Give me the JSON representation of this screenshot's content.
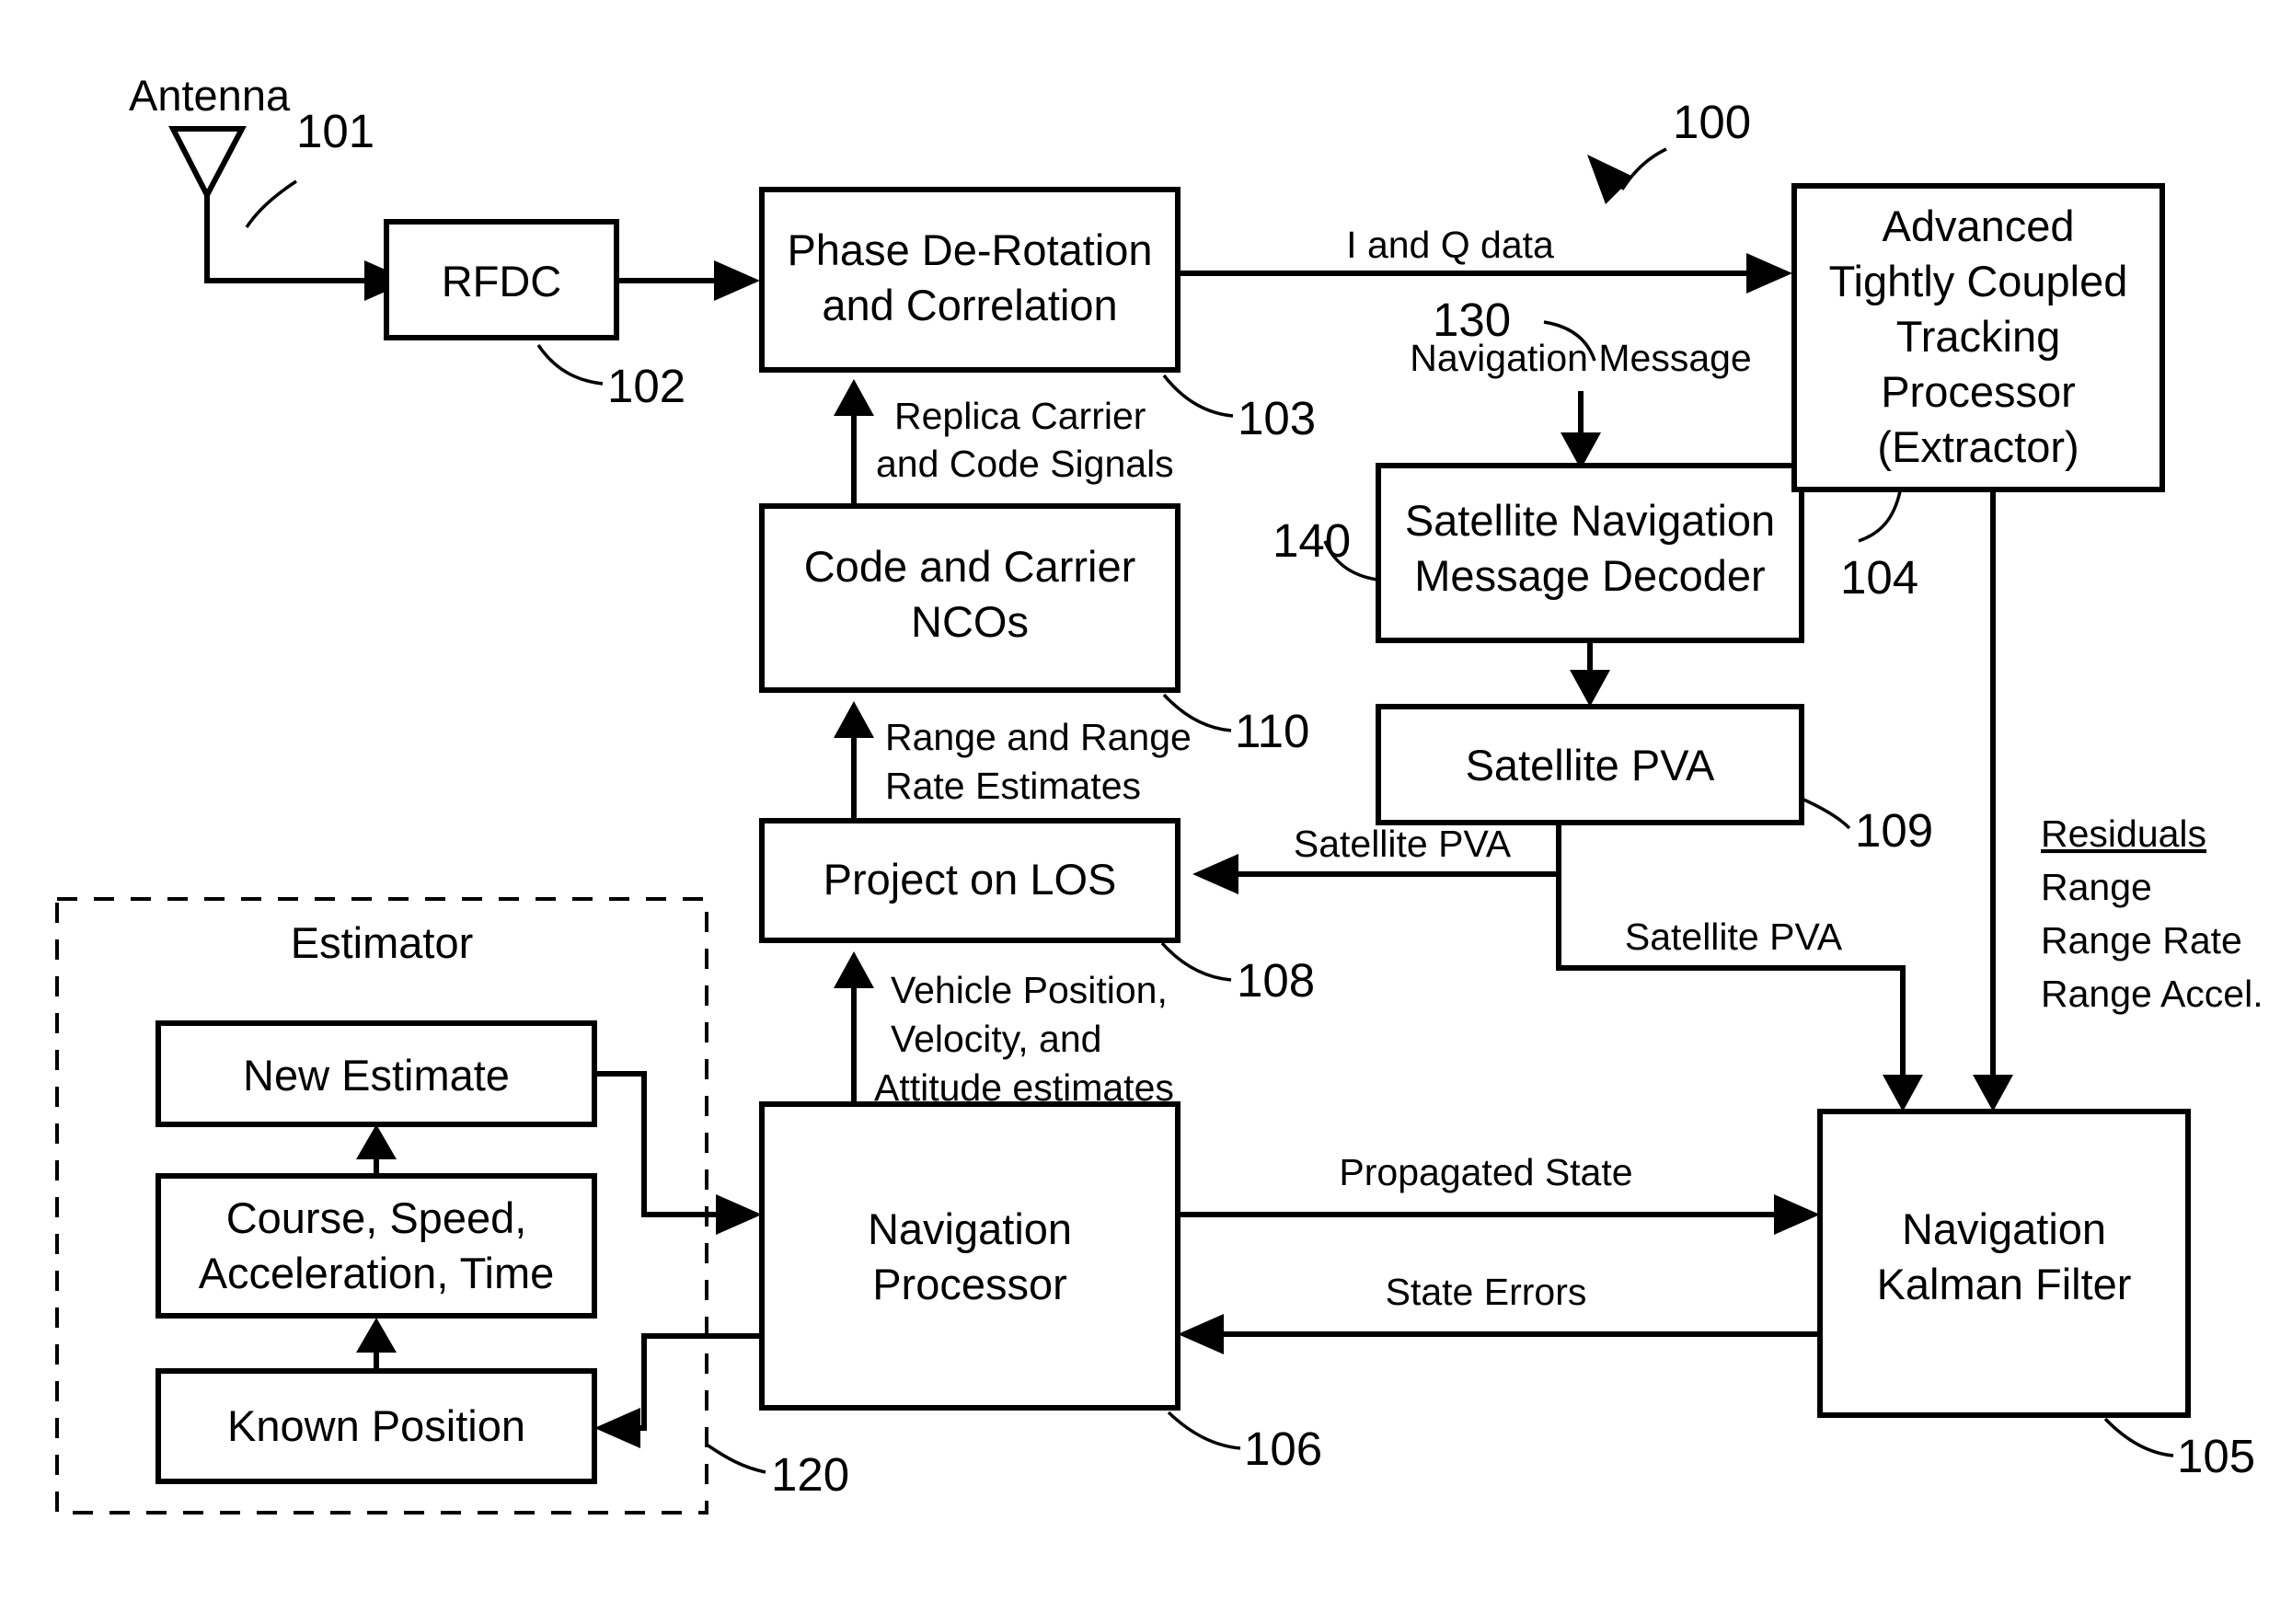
{
  "diagram": {
    "figure_ref": "100",
    "blocks": {
      "antenna_label": "Antenna",
      "rfdc": "RFDC",
      "phase_derot_l1": "Phase De-Rotation",
      "phase_derot_l2": "and Correlation",
      "ncos_l1": "Code and Carrier",
      "ncos_l2": "NCOs",
      "project_los": "Project on LOS",
      "nav_processor_l1": "Navigation",
      "nav_processor_l2": "Processor",
      "sat_decoder_l1": "Satellite Navigation",
      "sat_decoder_l2": "Message Decoder",
      "sat_pva": "Satellite PVA",
      "atc_l1": "Advanced",
      "atc_l2": "Tightly Coupled",
      "atc_l3": "Tracking",
      "atc_l4": "Processor",
      "atc_l5": "(Extractor)",
      "kalman_l1": "Navigation",
      "kalman_l2": "Kalman Filter",
      "estimator_title": "Estimator",
      "new_estimate": "New Estimate",
      "course_l1": "Course, Speed,",
      "course_l2": "Acceleration, Time",
      "known_position": "Known Position"
    },
    "refs": {
      "antenna": "101",
      "rfdc": "102",
      "phase_derot": "103",
      "atc_processor": "104",
      "kalman": "105",
      "nav_processor": "106",
      "project_los": "108",
      "sat_pva": "109",
      "ncos": "110",
      "estimator": "120",
      "nav_message": "130",
      "sat_decoder": "140"
    },
    "edges": {
      "iq_data": "I and Q data",
      "nav_message": "Navigation Message",
      "replica_l1": "Replica Carrier",
      "replica_l2": "and Code Signals",
      "range_l1": "Range and Range",
      "range_l2": "Rate Estimates",
      "sat_pva_to_los": "Satellite PVA",
      "sat_pva_to_kf": "Satellite PVA",
      "vehicle_l1": "Vehicle Position,",
      "vehicle_l2": "Velocity, and",
      "vehicle_l3": "Attitude estimates",
      "propagated_state": "Propagated State",
      "state_errors": "State Errors"
    },
    "residuals": {
      "heading": "Residuals",
      "items": [
        "Range",
        "Range Rate",
        "Range Accel."
      ]
    }
  }
}
